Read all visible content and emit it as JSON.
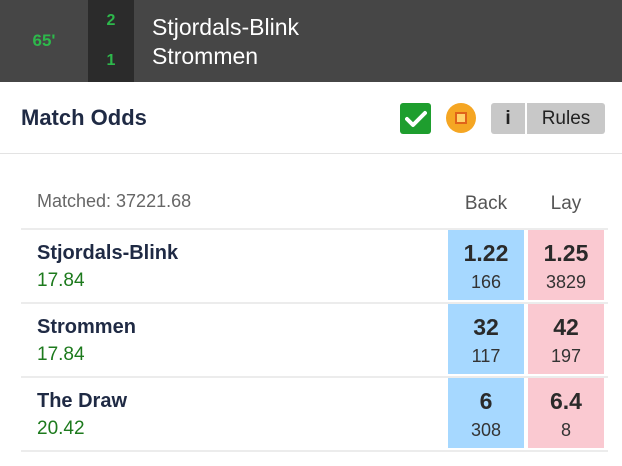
{
  "event": {
    "clock": "65'",
    "home_score": "2",
    "away_score": "1",
    "home_team": "Stjordals-Blink",
    "away_team": "Strommen"
  },
  "market": {
    "title": "Match Odds",
    "info_label": "i",
    "rules_label": "Rules",
    "matched_text": "Matched: 37221.68",
    "back_header": "Back",
    "lay_header": "Lay"
  },
  "runners": [
    {
      "name": "Stjordals-Blink",
      "matched": "17.84",
      "back_price": "1.22",
      "back_size": "166",
      "lay_price": "1.25",
      "lay_size": "3829"
    },
    {
      "name": "Strommen",
      "matched": "17.84",
      "back_price": "32",
      "back_size": "117",
      "lay_price": "42",
      "lay_size": "197"
    },
    {
      "name": "The Draw",
      "matched": "20.42",
      "back_price": "6",
      "back_size": "308",
      "lay_price": "6.4",
      "lay_size": "8"
    }
  ],
  "colors": {
    "header_bg": "#464646",
    "score_green": "#2db84b",
    "back_blue": "#a6d8ff",
    "lay_pink": "#fac9d1",
    "matched_green": "#1d7a1d"
  },
  "icons": {
    "check": "check-icon",
    "live": "live-stream-icon"
  }
}
